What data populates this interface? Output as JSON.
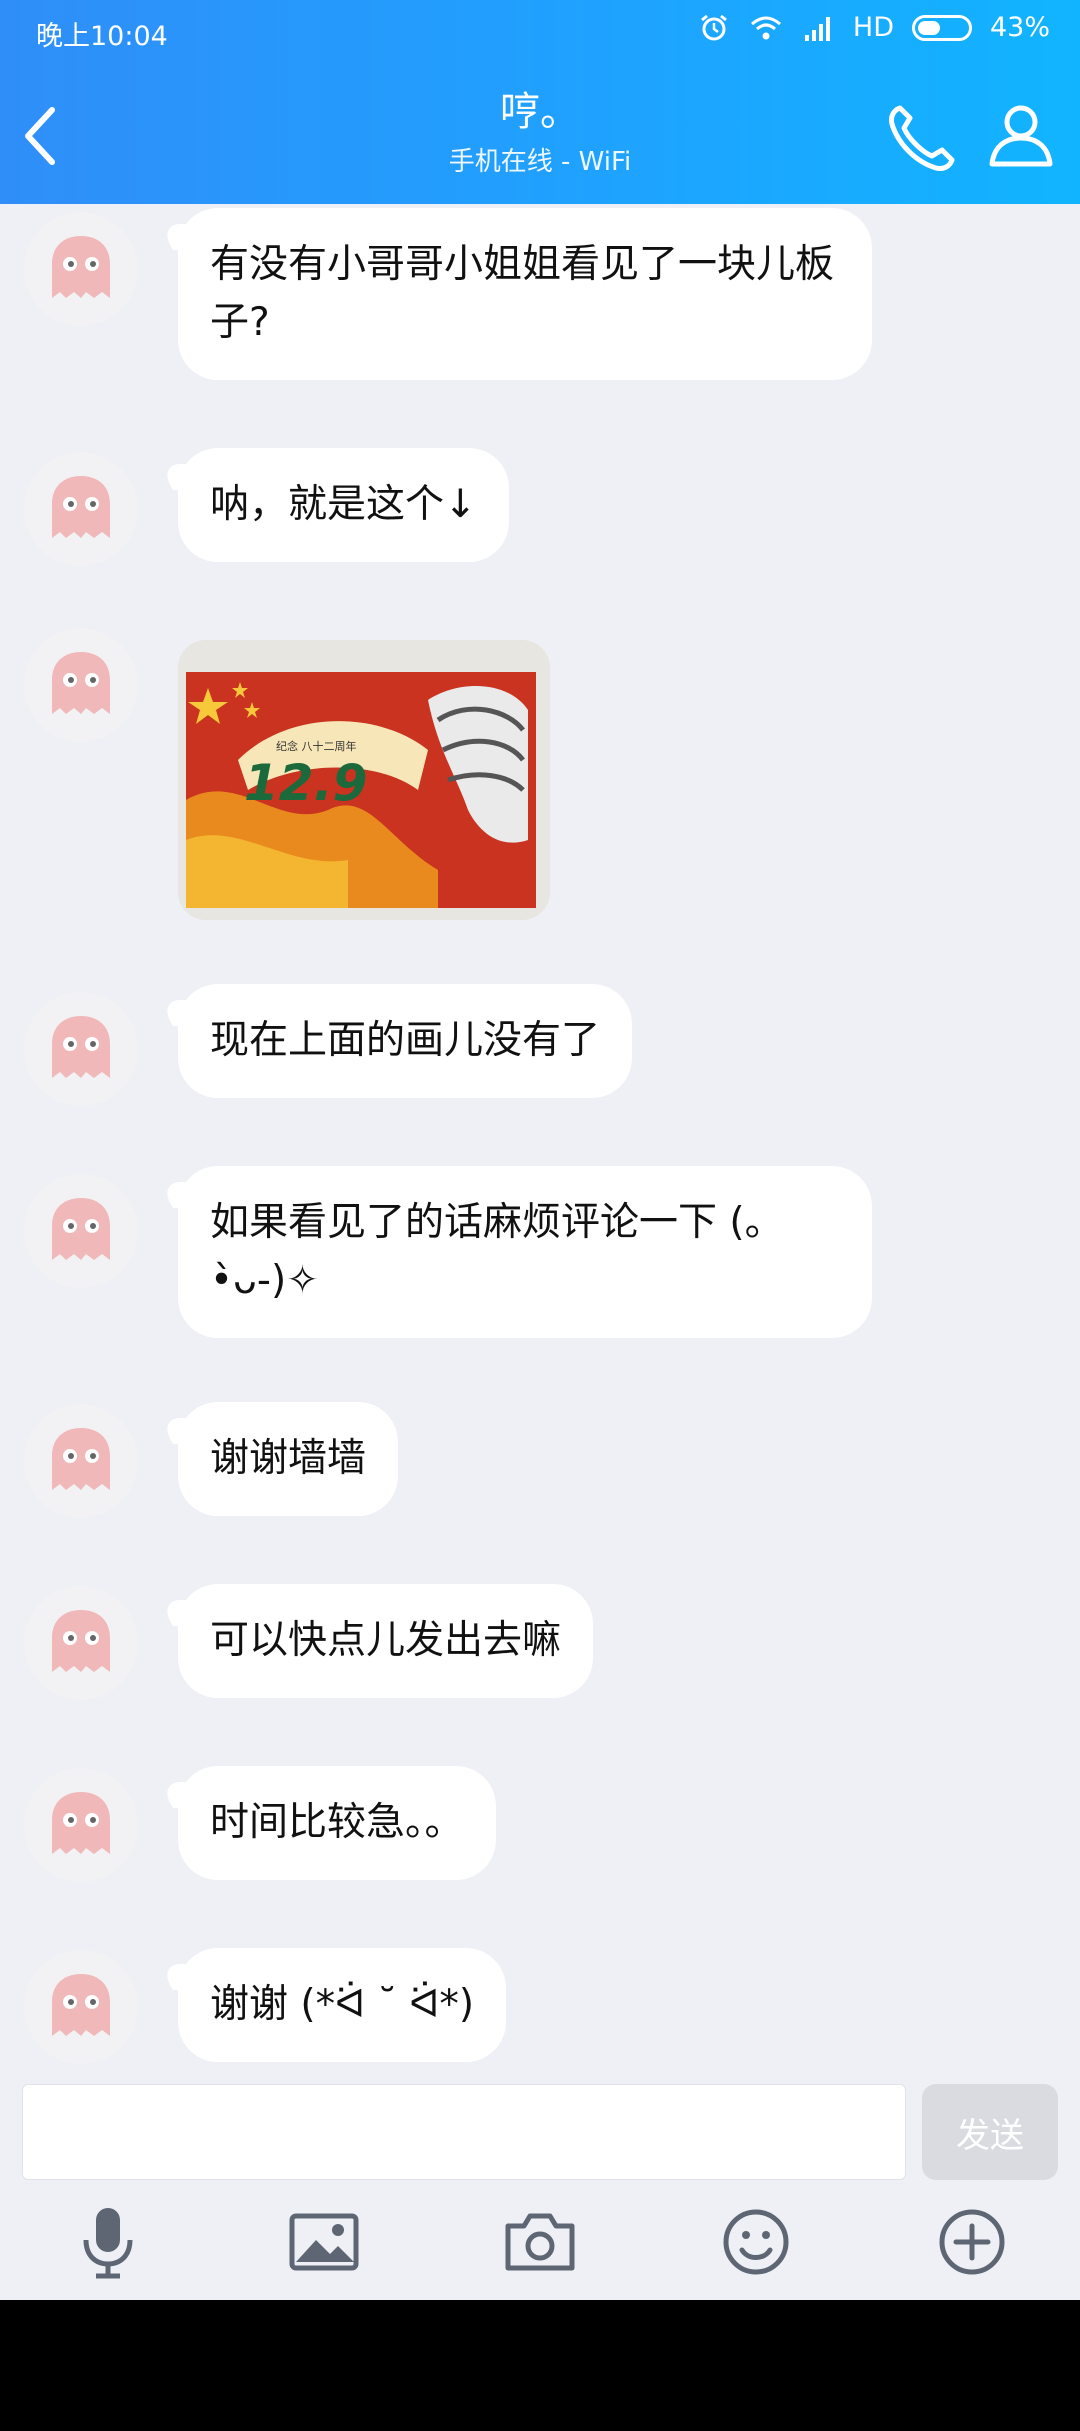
{
  "status_bar": {
    "time": "晚上10:04",
    "network": "HD",
    "battery": "43%"
  },
  "header": {
    "title": "哼。",
    "subtitle": "手机在线 - WiFi",
    "back_icon": "chevron-left-icon",
    "call_icon": "phone-icon",
    "profile_icon": "person-icon"
  },
  "messages": [
    {
      "type": "text",
      "text": "有没有小哥哥小姐姐看见了一块儿板子?"
    },
    {
      "type": "text",
      "text": "呐，就是这个↓"
    },
    {
      "type": "image",
      "caption": "12.9",
      "small_text": "纪念 八十二周年"
    },
    {
      "type": "text",
      "text": "现在上面的画儿没有了"
    },
    {
      "type": "text",
      "text": "如果看见了的话麻烦评论一下 (。•̀ᴗ-)✧"
    },
    {
      "type": "text",
      "text": "谢谢墙墙"
    },
    {
      "type": "text",
      "text": "可以快点儿发出去嘛"
    },
    {
      "type": "text",
      "text": "时间比较急。。"
    },
    {
      "type": "text",
      "text": "谢谢 (*ᐛ ˘ ᐛ*)"
    }
  ],
  "input": {
    "value": "",
    "placeholder": "",
    "send_label": "发送"
  },
  "toolbar": {
    "items": [
      {
        "icon": "microphone-icon"
      },
      {
        "icon": "image-icon"
      },
      {
        "icon": "camera-icon"
      },
      {
        "icon": "emoji-icon"
      },
      {
        "icon": "plus-icon"
      }
    ]
  },
  "colors": {
    "header_start": "#2f8ef8",
    "header_end": "#11b4ff",
    "background": "#eef0f6",
    "bubble": "#ffffff",
    "send_button": "#d9dbe1"
  }
}
